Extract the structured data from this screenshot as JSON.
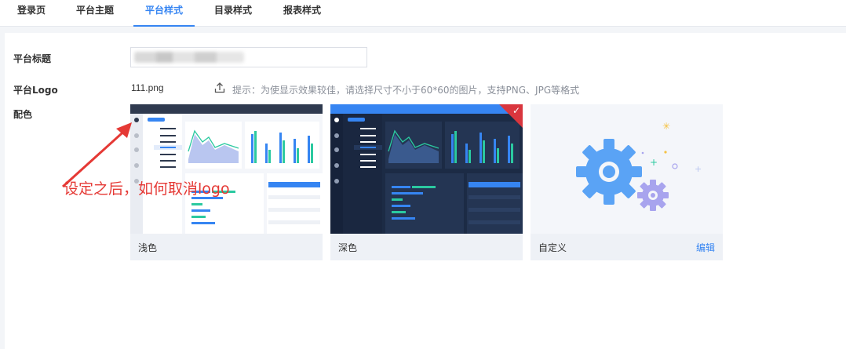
{
  "tabs": [
    {
      "label": "登录页",
      "active": false
    },
    {
      "label": "平台主题",
      "active": false
    },
    {
      "label": "平台样式",
      "active": true
    },
    {
      "label": "目录样式",
      "active": false
    },
    {
      "label": "报表样式",
      "active": false
    }
  ],
  "form": {
    "title_label": "平台标题",
    "logo_label": "平台Logo",
    "color_label": "配色",
    "logo_file": "111.png",
    "hint": "提示：为使显示效果较佳，请选择尺寸不小于60*60的图片，支持PNG、JPG等格式"
  },
  "themes": [
    {
      "label": "浅色",
      "selected": false
    },
    {
      "label": "深色",
      "selected": true
    },
    {
      "label": "自定义",
      "selected": false,
      "edit_label": "编辑"
    }
  ],
  "annotation": "设定之后，如何取消logo",
  "colors": {
    "accent": "#3685f2",
    "annotation": "#e53935",
    "dark_bg": "#1c2b45"
  }
}
